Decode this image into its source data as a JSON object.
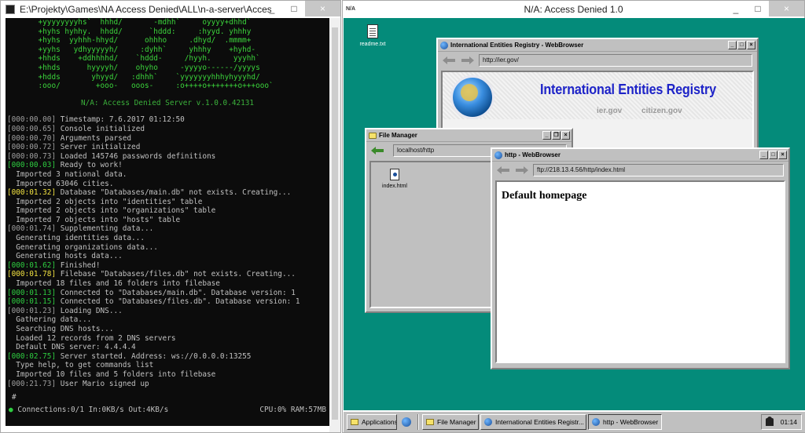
{
  "console": {
    "title": "E:\\Projekty\\Games\\NA Access Denied\\ALL\\n-a-server\\AccessDenied Server\\bin...",
    "ascii_art": [
      "       +yyyyyyyyhs`  hhhd/       -mdhh`     oyyyy+dhhd`",
      "       +hyhs hyhhy.  hhdd/      `hddd:     :hyyd. yhhhy",
      "       +hyhs  yyhhh-hhyd/      ohhho     .dhyd/  .mmmm+",
      "       +yyhs   ydhyyyyyh/     :dyhh`     yhhhy    +hyhd-",
      "       +hhds    +ddhhhhd/    `hddd-     /hyyh.     yyyhh`",
      "       +hhds      hyyyyh/    ohyho     -yyyyo------/yyyys",
      "       +hdds       yhyyd/   :dhhh`    `yyyyyyyhhhyhyyyhd/",
      "       :ooo/        +ooo-   ooos-     :o++++o+++++++o+++ooo`"
    ],
    "banner": "N/A: Access Denied Server v.1.0.0.42131",
    "log": [
      {
        "ts": "[000:00.00]",
        "color": "gray",
        "text": " Timestamp: 7.6.2017 01:12:50"
      },
      {
        "ts": "[000:00.65]",
        "color": "gray",
        "text": " Console initialized"
      },
      {
        "ts": "[000:00.70]",
        "color": "gray",
        "text": " Arguments parsed"
      },
      {
        "ts": "[000:00.72]",
        "color": "gray",
        "text": " Server initialized"
      },
      {
        "ts": "[000:00.73]",
        "color": "gray",
        "text": " Loaded 145746 passwords definitions"
      },
      {
        "ts": "[000:00.03]",
        "color": "green",
        "text": " Ready to work!"
      },
      {
        "ts": "",
        "color": "none",
        "text": "  Imported 3 national data."
      },
      {
        "ts": "",
        "color": "none",
        "text": "  Imported 63046 cities."
      },
      {
        "ts": "[000:01.32]",
        "color": "yellow",
        "text": " Database \"Databases/main.db\" not exists. Creating..."
      },
      {
        "ts": "",
        "color": "none",
        "text": "  Imported 2 objects into \"identities\" table"
      },
      {
        "ts": "",
        "color": "none",
        "text": "  Imported 2 objects into \"organizations\" table"
      },
      {
        "ts": "",
        "color": "none",
        "text": "  Imported 7 objects into \"hosts\" table"
      },
      {
        "ts": "[000:01.74]",
        "color": "gray",
        "text": " Supplementing data..."
      },
      {
        "ts": "",
        "color": "none",
        "text": "  Generating identities data..."
      },
      {
        "ts": "",
        "color": "none",
        "text": "  Generating organizations data..."
      },
      {
        "ts": "",
        "color": "none",
        "text": "  Generating hosts data..."
      },
      {
        "ts": "[000:01.62]",
        "color": "green",
        "text": " Finished!"
      },
      {
        "ts": "[000:01.78]",
        "color": "yellow",
        "text": " Filebase \"Databases/files.db\" not exists. Creating..."
      },
      {
        "ts": "",
        "color": "none",
        "text": "  Imported 18 files and 16 folders into filebase"
      },
      {
        "ts": "[000:01.13]",
        "color": "green",
        "text": " Connected to \"Databases/main.db\". Database version: 1"
      },
      {
        "ts": "[000:01.15]",
        "color": "green",
        "text": " Connected to \"Databases/files.db\". Database version: 1"
      },
      {
        "ts": "[000:01.23]",
        "color": "gray",
        "text": " Loading DNS..."
      },
      {
        "ts": "",
        "color": "none",
        "text": "  Gathering data..."
      },
      {
        "ts": "",
        "color": "none",
        "text": "  Searching DNS hosts..."
      },
      {
        "ts": "",
        "color": "none",
        "text": "  Loaded 12 records from 2 DNS servers"
      },
      {
        "ts": "",
        "color": "none",
        "text": "  Default DNS server: 4.4.4.4"
      },
      {
        "ts": "[000:02.75]",
        "color": "green",
        "text": " Server started. Address: ws://0.0.0.0:13255"
      },
      {
        "ts": "",
        "color": "none",
        "text": "  Type help, to get commands list"
      },
      {
        "ts": "",
        "color": "none",
        "text": "  Imported 10 files and 5 folders into filebase"
      },
      {
        "ts": "[000:21.73]",
        "color": "gray",
        "text": " User Mario signed up"
      }
    ],
    "prompt": "#",
    "status_left": "Connections:0/1 In:0KB/s Out:4KB/s",
    "status_right": "CPU:0% RAM:57MB",
    "status_dot": "●"
  },
  "desktop_window": {
    "title": "N/A: Access Denied 1.0",
    "icon_label": "N/A"
  },
  "desktop": {
    "icon_label": "readme.txt",
    "bg_color": "#048b7a"
  },
  "ier_window": {
    "title": "International Entities Registry - WebBrowser",
    "url": "http://ier.gov/",
    "heading": "International Entities Registry",
    "link1": "ier.gov",
    "link2": "citizen.gov"
  },
  "file_manager": {
    "title": "File Manager",
    "path": "localhost/http",
    "file_label": "index.html"
  },
  "http_window": {
    "title": "http - WebBrowser",
    "url": "ftp://218.13.4.56/http/index.html",
    "heading": "Default homepage"
  },
  "taskbar": {
    "apps_label": "Applications",
    "items": [
      "File Manager",
      "International Entities Registr...",
      "http - WebBrowser"
    ],
    "clock": "01:14"
  },
  "window_controls": {
    "min": "_",
    "max": "□",
    "close": "×",
    "restore": "❐"
  }
}
